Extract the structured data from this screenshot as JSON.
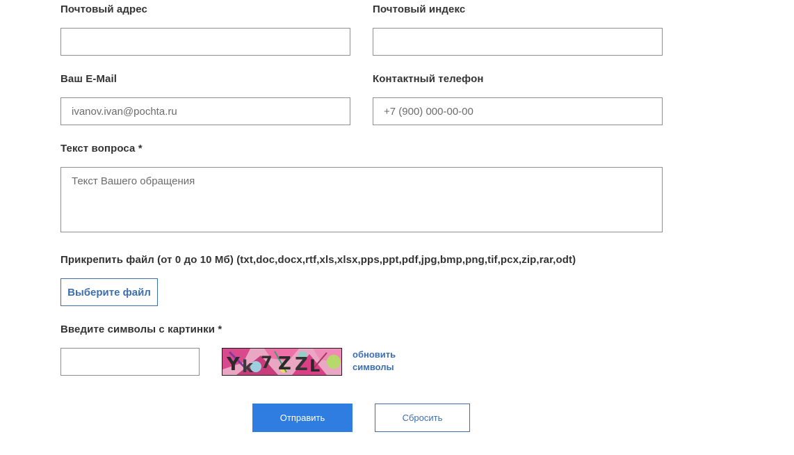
{
  "form": {
    "postal_address": {
      "label": "Почтовый адрес",
      "value": "",
      "placeholder": ""
    },
    "postal_code": {
      "label": "Почтовый индекс",
      "value": "",
      "placeholder": ""
    },
    "email": {
      "label": "Ваш E-Mail",
      "value": "",
      "placeholder": "ivanov.ivan@pochta.ru"
    },
    "phone": {
      "label": "Контактный телефон",
      "value": "",
      "placeholder": "+7 (900) 000-00-00"
    },
    "question": {
      "label": "Текст вопроса *",
      "value": "",
      "placeholder": "Текст Вашего обращения"
    },
    "attachment": {
      "label": "Прикрепить файл (от 0 до 10 Мб) (txt,doc,docx,rtf,xls,xlsx,pps,ppt,pdf,jpg,bmp,png,tif,pcx,zip,rar,odt)",
      "button_label": "Выберите файл"
    },
    "captcha": {
      "label": "Введите символы с картинки *",
      "value": "",
      "refresh_line1": "обновить",
      "refresh_line2": "символы"
    },
    "submit_label": "Отправить",
    "reset_label": "Сбросить"
  },
  "colors": {
    "accent": "#2f7de1",
    "link": "#3d6fb0",
    "border": "#8e8e8e"
  }
}
